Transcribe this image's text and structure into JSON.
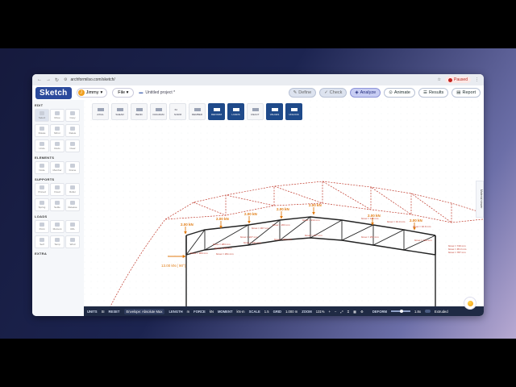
{
  "browser": {
    "url": "archformilso.com/sketch/",
    "profile_status": "Paused"
  },
  "header": {
    "logo": "Sketch",
    "user_initial": "J",
    "user_name": "Jimmy",
    "file_menu": "File",
    "project_name": "Untitled project *",
    "buttons": {
      "define": "Define",
      "check": "Check",
      "analyze": "Analyze",
      "animate": "Animate",
      "results": "Results",
      "report": "Report"
    }
  },
  "sidebar": {
    "sections": [
      {
        "title": "EDIT",
        "tools": [
          "Select",
          "Move",
          "Copy",
          "Rotate",
          "Mirror",
          "Delete",
          "Undo",
          "Redo",
          "Clear"
        ]
      },
      {
        "title": "ELEMENTS",
        "tools": [
          "Node",
          "Member",
          "Frame"
        ]
      },
      {
        "title": "SUPPORTS",
        "tools": [
          "Pinned",
          "Fixed",
          "Roller",
          "Spring",
          "Settle",
          "Release"
        ]
      },
      {
        "title": "LOADS",
        "tools": [
          "Point",
          "Moment",
          "UDL",
          "Self",
          "Temp",
          "Wind"
        ]
      },
      {
        "title": "EXTRA",
        "tools": []
      }
    ]
  },
  "ribbon": {
    "items": [
      "AXIAL",
      "SHEAR",
      "BEND",
      "DIAGRAM",
      "NORM",
      "MEMBER",
      "DEFORM",
      "LOADS",
      "REACT",
      "VALUES",
      "UNLOCK"
    ],
    "norm_label": "Σα"
  },
  "canvas": {
    "loads": [
      {
        "label": "2.00 kN"
      },
      {
        "label": "2.00 kN"
      },
      {
        "label": "2.00 kN"
      },
      {
        "label": "2.00 kN"
      },
      {
        "label": "2.00 kN"
      },
      {
        "label": "2.00 kN"
      },
      {
        "label": "2.00 kN"
      }
    ],
    "lateral_load": "13.00 kN ( 90°)",
    "member_labels": [
      "δmax = 283 mm",
      "δmax = 227 mm",
      "δmax = 307 mm",
      "δmax = 263 mm",
      "δmax = 214 mm",
      "δmax = 118 mm",
      "δmax = 31.3 mm",
      "δmax = 32.9 mm",
      "δmax = 283 mm",
      "δmax = 239 mm",
      "δmax = 241 mm",
      "δmax = 251 mm",
      "δmax = 217 mm",
      "δmax = 253 mm",
      "δmax = 129 mm",
      "δmax = 740 mm",
      "δmax = 291 mm",
      "δmax = 45.3 mm",
      "δmax = 787 mm"
    ],
    "axes": {
      "x": "x",
      "y": "y"
    },
    "side_tab": "Material viewer"
  },
  "status": {
    "units_label": "UNITS",
    "units_value": "SI",
    "reset": "RESET",
    "envelope": "Envelope: Absolute Max",
    "length_label": "LENGTH",
    "length_value": "m",
    "force_label": "FORCE",
    "force_value": "kN",
    "moment_label": "MOMENT",
    "moment_value": "kN·m",
    "scale_label": "SCALE",
    "scale_value": "1.5",
    "grid_label": "GRID",
    "grid_value": "1.000 m",
    "zoom_label": "ZOOM",
    "zoom_value": "131%",
    "deform_label": "DEFORM",
    "deform_value": "1.8x",
    "deform_level": 0.55,
    "mode": "Extruded"
  },
  "colors": {
    "brand": "#2b4a9c",
    "load": "#e07a10",
    "deform": "#c0392b",
    "structure": "#222222",
    "status_bar": "#1f2a44"
  }
}
